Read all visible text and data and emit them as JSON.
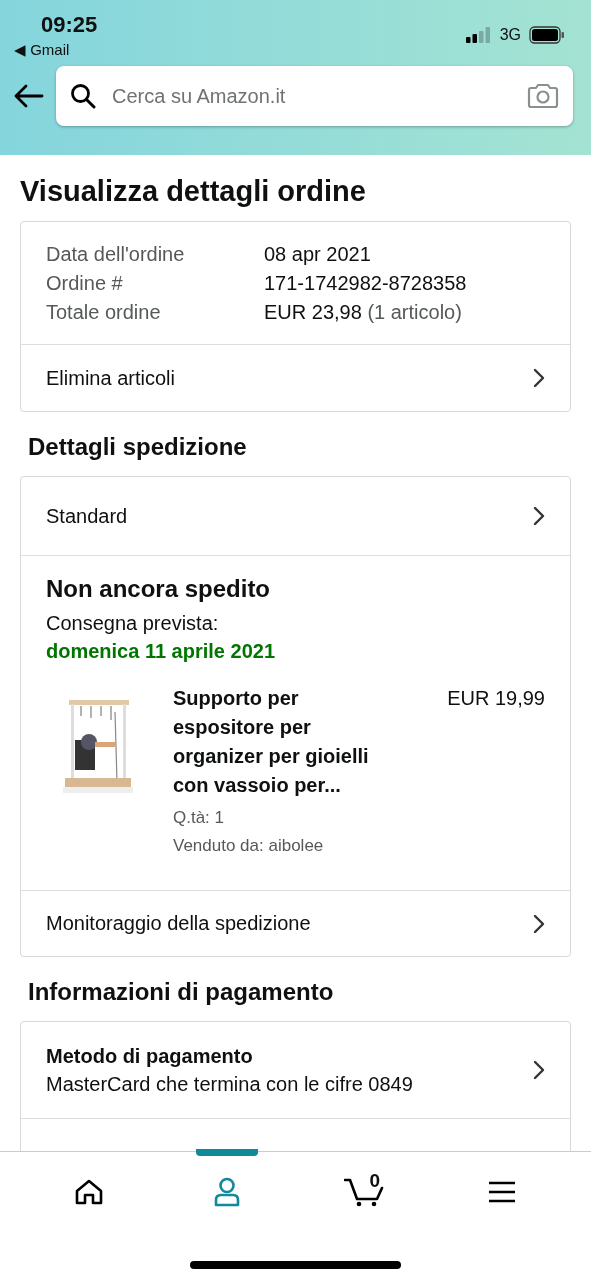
{
  "status_bar": {
    "time": "09:25",
    "back_app": "◀ Gmail",
    "network": "3G"
  },
  "search": {
    "placeholder": "Cerca su Amazon.it"
  },
  "title": "Visualizza dettagli ordine",
  "order_summary": {
    "rows": [
      {
        "label": "Data dell'ordine",
        "value": "08 apr 2021"
      },
      {
        "label": "Ordine #",
        "value": "171-1742982-8728358"
      },
      {
        "label": "Totale ordine",
        "value": "EUR 23,98",
        "note": "(1 articolo)"
      }
    ],
    "action": "Elimina articoli"
  },
  "shipping": {
    "heading": "Dettagli spedizione",
    "method": "Standard",
    "status": "Non ancora spedito",
    "delivery_label": "Consegna prevista:",
    "delivery_date": "domenica 11 aprile 2021",
    "item": {
      "kind": "picture",
      "title": "Supporto per espositore per organizer per gioielli con vassoio per...",
      "price": "EUR 19,99",
      "quantity": "Q.tà: 1",
      "seller": "Venduto da: aibolee"
    },
    "tracking": "Monitoraggio della spedizione"
  },
  "payment": {
    "heading": "Informazioni di pagamento",
    "method_label": "Metodo di pagamento",
    "method_value": "MasterCard che termina con le cifre 0849"
  },
  "tab_bar": [
    {
      "kind": "home",
      "selected": false
    },
    {
      "kind": "account",
      "selected": true
    },
    {
      "kind": "cart",
      "badge": "0",
      "selected": false
    },
    {
      "kind": "menu",
      "selected": false
    }
  ]
}
